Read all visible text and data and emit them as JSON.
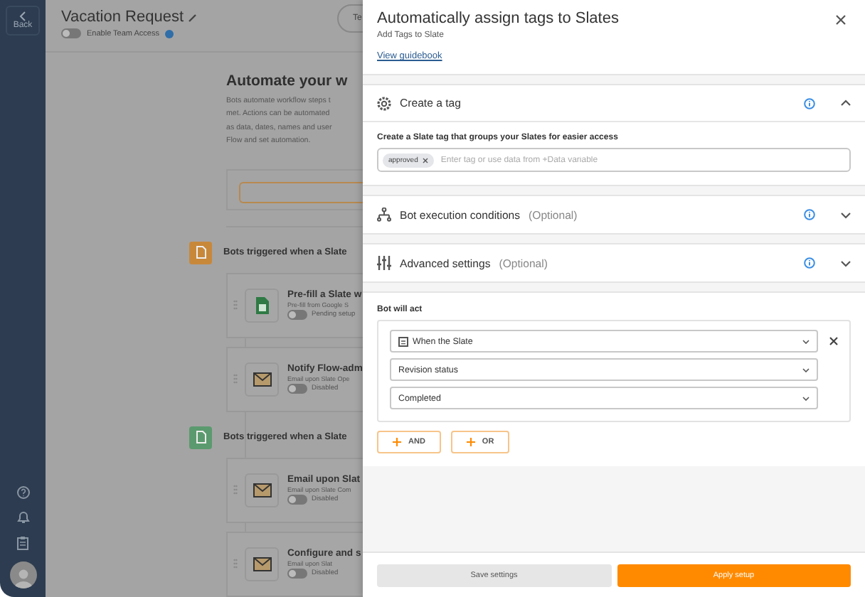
{
  "sidebar": {
    "back_label": "Back"
  },
  "header": {
    "title": "Vacation Request",
    "team_access": {
      "label": "Enable Team Access",
      "on": false
    },
    "button_label": "Te"
  },
  "intro": {
    "heading": "Automate your w",
    "lines": [
      "Bots automate workflow steps t",
      "met. Actions can be automated",
      "as data, dates, names and user",
      "Flow and set automation."
    ]
  },
  "bot_groups": [
    {
      "title": "Bots triggered when a Slate",
      "color": "#c8883a",
      "bots": [
        {
          "title": "Pre-fill a Slate w",
          "subtitle": "Pre-fill from Google S",
          "status": "Pending setup",
          "on": false,
          "kind": "sheet"
        },
        {
          "title": "Notify Flow-adm",
          "subtitle": "Email upon Slate Ope",
          "status": "Disabled",
          "on": false,
          "kind": "mail"
        }
      ]
    },
    {
      "title": "Bots triggered when a Slate",
      "color": "#5b9a6e",
      "bots": [
        {
          "title": "Email upon Slat",
          "subtitle": "Email upon Slate Com",
          "status": "Disabled",
          "on": false,
          "kind": "mail"
        },
        {
          "title": "Configure and s",
          "subtitle": "Email upon Slat",
          "status": "Disabled",
          "on": false,
          "kind": "mail"
        }
      ]
    }
  ],
  "panel": {
    "title": "Automatically assign tags to Slates",
    "subtitle": "Add Tags to Slate",
    "link": "View guidebook",
    "sections": [
      {
        "title": "Create a tag",
        "kind": "gear",
        "expanded": true,
        "field": {
          "label": "Create a Slate tag that groups your Slates for easier access",
          "tags": [
            "approved"
          ],
          "placeholder": "Enter tag or use data from +Data variable"
        }
      },
      {
        "title": "Bot execution conditions",
        "optional": "(Optional)",
        "kind": "flow",
        "expanded": false
      },
      {
        "title": "Advanced settings",
        "optional": "(Optional)",
        "kind": "sliders",
        "expanded": false
      }
    ],
    "bot_will_act": {
      "label": "Bot will act",
      "conditions": [
        {
          "value": "When the Slate",
          "kind": "trigger"
        },
        {
          "value": "Revision status",
          "kind": "plain"
        },
        {
          "value": "Completed",
          "kind": "plain"
        }
      ]
    },
    "logic_buttons": [
      "AND",
      "OR"
    ],
    "footer": {
      "save": "Save settings",
      "apply": "Apply setup"
    }
  }
}
